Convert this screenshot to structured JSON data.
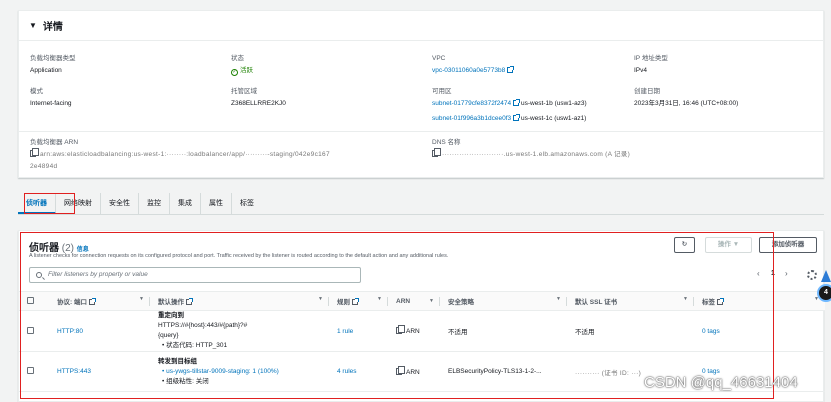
{
  "details": {
    "title": "详情",
    "lb_type_label": "负载均衡器类型",
    "lb_type": "Application",
    "status_label": "状态",
    "status": "活跃",
    "vpc_label": "VPC",
    "vpc": "vpc-03011060a0e5773b8",
    "ip_type_label": "IP 地址类型",
    "ip_type": "IPv4",
    "scheme_label": "模式",
    "scheme": "Internet-facing",
    "hosted_zone_label": "托管区域",
    "hosted_zone": "Z368ELLRRE2KJ0",
    "az_label": "可用区",
    "az1_subnet": "subnet-01779cfe8372f2474",
    "az1_name": "us-west-1b (usw1-az3)",
    "az2_subnet": "subnet-01f996a3b1dcee0f3",
    "az2_name": "us-west-1c (usw1-az1)",
    "created_label": "创建日期",
    "created": "2023年3月31日, 16:46 (UTC+08:00)",
    "arn_label": "负载均衡器 ARN",
    "arn_line1": "arn:aws:elasticloadbalancing:us-west-1:········:loadbalancer/app/·········-staging/042e9c167",
    "arn_line2": "2e4894d",
    "dns_label": "DNS 名称",
    "dns": "·························.us-west-1.elb.amazonaws.com (A 记录)"
  },
  "tabs": [
    "侦听器",
    "网络映射",
    "安全性",
    "监控",
    "集成",
    "属性",
    "标签"
  ],
  "listeners": {
    "title": "侦听器",
    "count": "(2)",
    "info": "信息",
    "description": "A listener checks for connection requests on its configured protocol and port. Traffic received by the listener is routed according to the default action and any additional rules.",
    "refresh_icon": "refresh-icon",
    "actions_label": "操作",
    "add_label": "添加侦听器",
    "search_placeholder": "Filter listeners by property or value",
    "page": "1",
    "columns": [
      "协议: 端口",
      "默认操作",
      "规则",
      "ARN",
      "安全策略",
      "默认 SSL 证书",
      "标签"
    ],
    "rows": [
      {
        "protocol": "HTTP:80",
        "action_title": "重定向到",
        "action_line1": "HTTPS://#{host}:443/#{path}?#",
        "action_line2": "{query}",
        "action_bullet": "• 状态代码: HTTP_301",
        "rules": "1 rule",
        "arn": "ARN",
        "policy": "不适用",
        "cert": "不适用",
        "tags": "0 tags"
      },
      {
        "protocol": "HTTPS:443",
        "action_title": "转发到目标组",
        "action_line1": "• us-ywgs-tillstar-9009-staging: 1 (100%)",
        "action_line2": "• 组级粘性: 关闭",
        "action_bullet": "",
        "rules": "4 rules",
        "arn": "ARN",
        "policy": "ELBSecurityPolicy-TLS13-1-2-...",
        "cert": "·········· (证书 ID: ···)",
        "tags": "0 tags"
      }
    ]
  },
  "watermark": "CSDN @qq_46631404",
  "widget_text": "4"
}
